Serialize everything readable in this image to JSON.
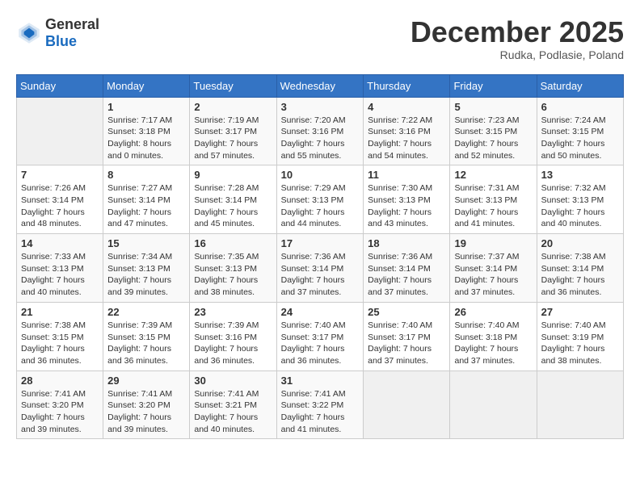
{
  "header": {
    "logo_general": "General",
    "logo_blue": "Blue",
    "month": "December 2025",
    "location": "Rudka, Podlasie, Poland"
  },
  "weekdays": [
    "Sunday",
    "Monday",
    "Tuesday",
    "Wednesday",
    "Thursday",
    "Friday",
    "Saturday"
  ],
  "weeks": [
    [
      {
        "day": "",
        "sunrise": "",
        "sunset": "",
        "daylight": ""
      },
      {
        "day": "1",
        "sunrise": "Sunrise: 7:17 AM",
        "sunset": "Sunset: 3:18 PM",
        "daylight": "Daylight: 8 hours and 0 minutes."
      },
      {
        "day": "2",
        "sunrise": "Sunrise: 7:19 AM",
        "sunset": "Sunset: 3:17 PM",
        "daylight": "Daylight: 7 hours and 57 minutes."
      },
      {
        "day": "3",
        "sunrise": "Sunrise: 7:20 AM",
        "sunset": "Sunset: 3:16 PM",
        "daylight": "Daylight: 7 hours and 55 minutes."
      },
      {
        "day": "4",
        "sunrise": "Sunrise: 7:22 AM",
        "sunset": "Sunset: 3:16 PM",
        "daylight": "Daylight: 7 hours and 54 minutes."
      },
      {
        "day": "5",
        "sunrise": "Sunrise: 7:23 AM",
        "sunset": "Sunset: 3:15 PM",
        "daylight": "Daylight: 7 hours and 52 minutes."
      },
      {
        "day": "6",
        "sunrise": "Sunrise: 7:24 AM",
        "sunset": "Sunset: 3:15 PM",
        "daylight": "Daylight: 7 hours and 50 minutes."
      }
    ],
    [
      {
        "day": "7",
        "sunrise": "Sunrise: 7:26 AM",
        "sunset": "Sunset: 3:14 PM",
        "daylight": "Daylight: 7 hours and 48 minutes."
      },
      {
        "day": "8",
        "sunrise": "Sunrise: 7:27 AM",
        "sunset": "Sunset: 3:14 PM",
        "daylight": "Daylight: 7 hours and 47 minutes."
      },
      {
        "day": "9",
        "sunrise": "Sunrise: 7:28 AM",
        "sunset": "Sunset: 3:14 PM",
        "daylight": "Daylight: 7 hours and 45 minutes."
      },
      {
        "day": "10",
        "sunrise": "Sunrise: 7:29 AM",
        "sunset": "Sunset: 3:13 PM",
        "daylight": "Daylight: 7 hours and 44 minutes."
      },
      {
        "day": "11",
        "sunrise": "Sunrise: 7:30 AM",
        "sunset": "Sunset: 3:13 PM",
        "daylight": "Daylight: 7 hours and 43 minutes."
      },
      {
        "day": "12",
        "sunrise": "Sunrise: 7:31 AM",
        "sunset": "Sunset: 3:13 PM",
        "daylight": "Daylight: 7 hours and 41 minutes."
      },
      {
        "day": "13",
        "sunrise": "Sunrise: 7:32 AM",
        "sunset": "Sunset: 3:13 PM",
        "daylight": "Daylight: 7 hours and 40 minutes."
      }
    ],
    [
      {
        "day": "14",
        "sunrise": "Sunrise: 7:33 AM",
        "sunset": "Sunset: 3:13 PM",
        "daylight": "Daylight: 7 hours and 40 minutes."
      },
      {
        "day": "15",
        "sunrise": "Sunrise: 7:34 AM",
        "sunset": "Sunset: 3:13 PM",
        "daylight": "Daylight: 7 hours and 39 minutes."
      },
      {
        "day": "16",
        "sunrise": "Sunrise: 7:35 AM",
        "sunset": "Sunset: 3:13 PM",
        "daylight": "Daylight: 7 hours and 38 minutes."
      },
      {
        "day": "17",
        "sunrise": "Sunrise: 7:36 AM",
        "sunset": "Sunset: 3:14 PM",
        "daylight": "Daylight: 7 hours and 37 minutes."
      },
      {
        "day": "18",
        "sunrise": "Sunrise: 7:36 AM",
        "sunset": "Sunset: 3:14 PM",
        "daylight": "Daylight: 7 hours and 37 minutes."
      },
      {
        "day": "19",
        "sunrise": "Sunrise: 7:37 AM",
        "sunset": "Sunset: 3:14 PM",
        "daylight": "Daylight: 7 hours and 37 minutes."
      },
      {
        "day": "20",
        "sunrise": "Sunrise: 7:38 AM",
        "sunset": "Sunset: 3:14 PM",
        "daylight": "Daylight: 7 hours and 36 minutes."
      }
    ],
    [
      {
        "day": "21",
        "sunrise": "Sunrise: 7:38 AM",
        "sunset": "Sunset: 3:15 PM",
        "daylight": "Daylight: 7 hours and 36 minutes."
      },
      {
        "day": "22",
        "sunrise": "Sunrise: 7:39 AM",
        "sunset": "Sunset: 3:15 PM",
        "daylight": "Daylight: 7 hours and 36 minutes."
      },
      {
        "day": "23",
        "sunrise": "Sunrise: 7:39 AM",
        "sunset": "Sunset: 3:16 PM",
        "daylight": "Daylight: 7 hours and 36 minutes."
      },
      {
        "day": "24",
        "sunrise": "Sunrise: 7:40 AM",
        "sunset": "Sunset: 3:17 PM",
        "daylight": "Daylight: 7 hours and 36 minutes."
      },
      {
        "day": "25",
        "sunrise": "Sunrise: 7:40 AM",
        "sunset": "Sunset: 3:17 PM",
        "daylight": "Daylight: 7 hours and 37 minutes."
      },
      {
        "day": "26",
        "sunrise": "Sunrise: 7:40 AM",
        "sunset": "Sunset: 3:18 PM",
        "daylight": "Daylight: 7 hours and 37 minutes."
      },
      {
        "day": "27",
        "sunrise": "Sunrise: 7:40 AM",
        "sunset": "Sunset: 3:19 PM",
        "daylight": "Daylight: 7 hours and 38 minutes."
      }
    ],
    [
      {
        "day": "28",
        "sunrise": "Sunrise: 7:41 AM",
        "sunset": "Sunset: 3:20 PM",
        "daylight": "Daylight: 7 hours and 39 minutes."
      },
      {
        "day": "29",
        "sunrise": "Sunrise: 7:41 AM",
        "sunset": "Sunset: 3:20 PM",
        "daylight": "Daylight: 7 hours and 39 minutes."
      },
      {
        "day": "30",
        "sunrise": "Sunrise: 7:41 AM",
        "sunset": "Sunset: 3:21 PM",
        "daylight": "Daylight: 7 hours and 40 minutes."
      },
      {
        "day": "31",
        "sunrise": "Sunrise: 7:41 AM",
        "sunset": "Sunset: 3:22 PM",
        "daylight": "Daylight: 7 hours and 41 minutes."
      },
      {
        "day": "",
        "sunrise": "",
        "sunset": "",
        "daylight": ""
      },
      {
        "day": "",
        "sunrise": "",
        "sunset": "",
        "daylight": ""
      },
      {
        "day": "",
        "sunrise": "",
        "sunset": "",
        "daylight": ""
      }
    ]
  ]
}
